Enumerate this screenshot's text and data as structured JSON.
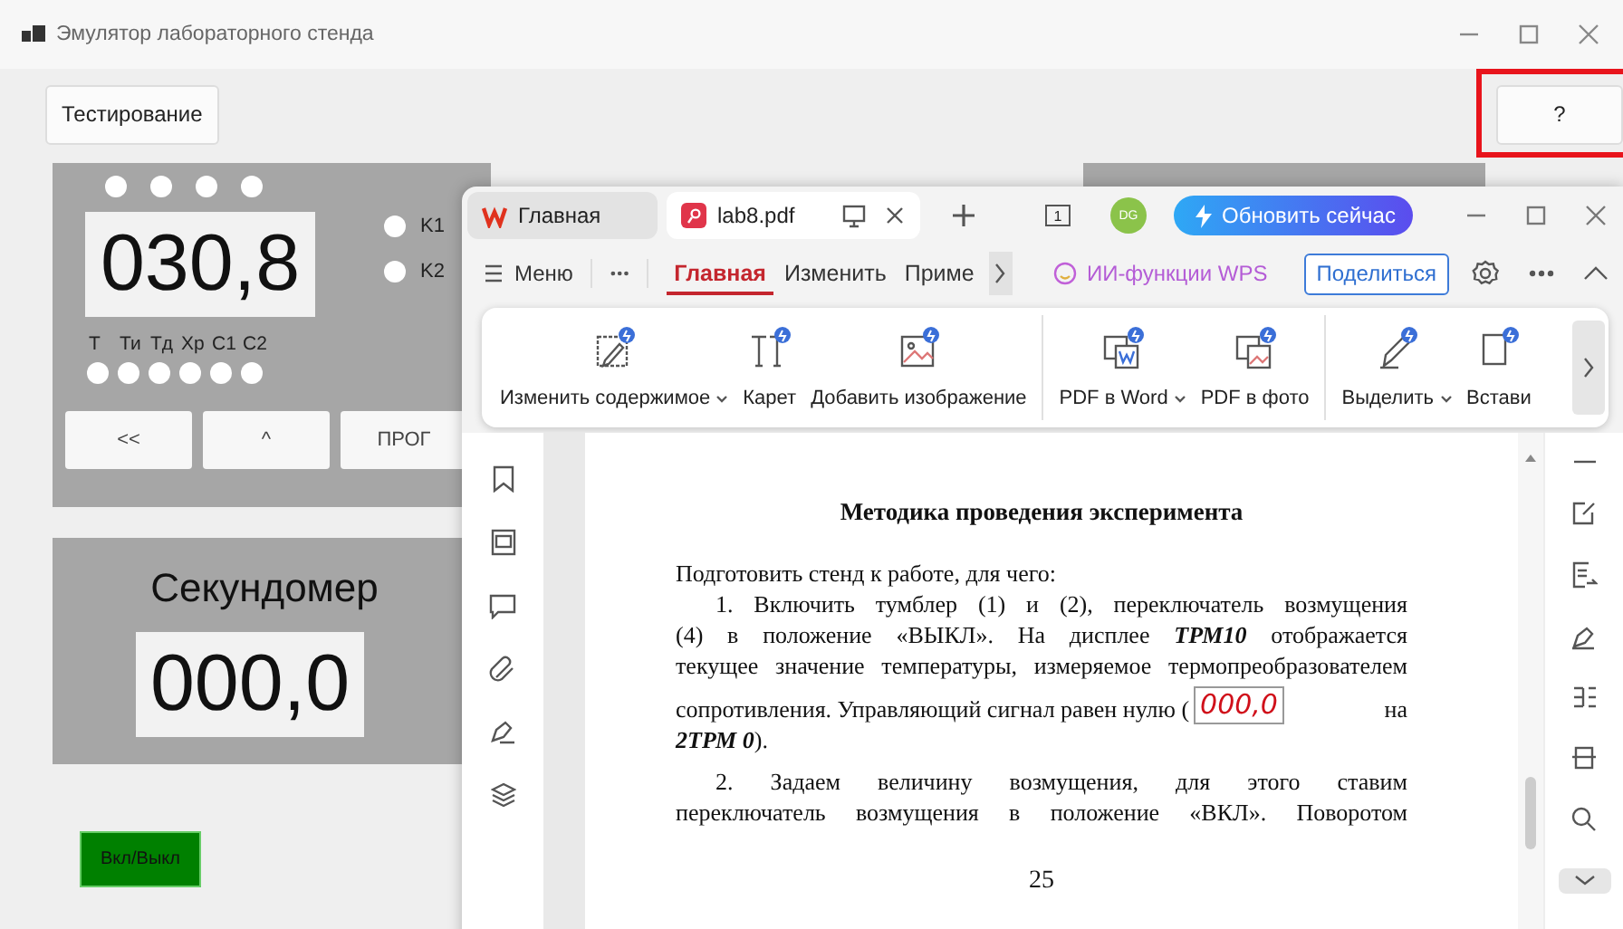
{
  "window": {
    "title": "Эмулятор лабораторного стенда"
  },
  "toolbar": {
    "buttons": [
      {
        "label": "Тестирование",
        "highlighted": false
      },
      {
        "label": "?",
        "highlighted": true
      }
    ]
  },
  "stand": {
    "display": "030,8",
    "channels": [
      {
        "label": "K1"
      },
      {
        "label": "K2"
      }
    ],
    "modes": [
      "Т",
      "Ти",
      "Тд",
      "Хр",
      "С1",
      "С2"
    ],
    "buttons": [
      "<<",
      "^",
      "ПРОГ"
    ]
  },
  "stopwatch": {
    "title": "Секундомер",
    "display": "000,0"
  },
  "power_button": {
    "label": "Вкл/Выкл"
  },
  "pdf_viewer": {
    "tabs": [
      {
        "label": "Главная",
        "selected": false,
        "kind": "home"
      },
      {
        "label": "lab8.pdf",
        "selected": true,
        "kind": "pdf"
      }
    ],
    "view_badge": "1",
    "avatar": "DG",
    "update_button": "Обновить сейчас",
    "menu": "Меню",
    "ribbon_tabs": [
      {
        "label": "Главная",
        "selected": true
      },
      {
        "label": "Изменить",
        "selected": false
      },
      {
        "label": "Приме",
        "selected": false
      }
    ],
    "ai_button": "ИИ-функции WPS",
    "share_button": "Поделиться",
    "tools": [
      {
        "label": "Изменить содержимое",
        "kind": "edit",
        "dropdown": true,
        "group_end": false
      },
      {
        "label": "Карет",
        "kind": "text",
        "dropdown": false,
        "group_end": false
      },
      {
        "label": "Добавить изображение",
        "kind": "image",
        "dropdown": false,
        "group_end": true
      },
      {
        "label": "PDF в Word",
        "kind": "word",
        "dropdown": true,
        "group_end": false
      },
      {
        "label": "PDF в фото",
        "kind": "photo",
        "dropdown": false,
        "group_end": true
      },
      {
        "label": "Выделить",
        "kind": "highlight",
        "dropdown": true,
        "group_end": false
      },
      {
        "label": "Встави",
        "kind": "insert",
        "dropdown": false,
        "group_end": false
      }
    ],
    "page": {
      "heading": "Методика проведения эксперимента",
      "lines": [
        {
          "kind": "text",
          "indent": false,
          "justify": false,
          "text": "Подготовить стенд к работе, для чего:"
        },
        {
          "kind": "text",
          "indent": true,
          "justify": true,
          "text": "1.  Включить тумблер (1) и (2), переключатель возмущения"
        },
        {
          "kind": "text",
          "indent": false,
          "justify": true,
          "text": "(4) в положение «ВЫКЛ». На дисплее **ТРМ10** отображается"
        },
        {
          "kind": "text",
          "indent": false,
          "justify": true,
          "text": "текущее значение температуры, измеряемое термопреобразователем"
        },
        {
          "kind": "display_line",
          "text_before": "сопротивления. Управляющий сигнал равен нулю (",
          "display": "000,0",
          "text_after": "на"
        },
        {
          "kind": "text",
          "indent": false,
          "justify": false,
          "text": "**2ТРМ 0**)."
        },
        {
          "kind": "text",
          "indent": true,
          "justify": true,
          "text": "2. Задаем величину возмущения, для этого ставим"
        },
        {
          "kind": "text",
          "indent": false,
          "justify": true,
          "text": "переключатель возмущения в положение «ВКЛ». Поворотом"
        }
      ],
      "page_number": "25"
    }
  }
}
